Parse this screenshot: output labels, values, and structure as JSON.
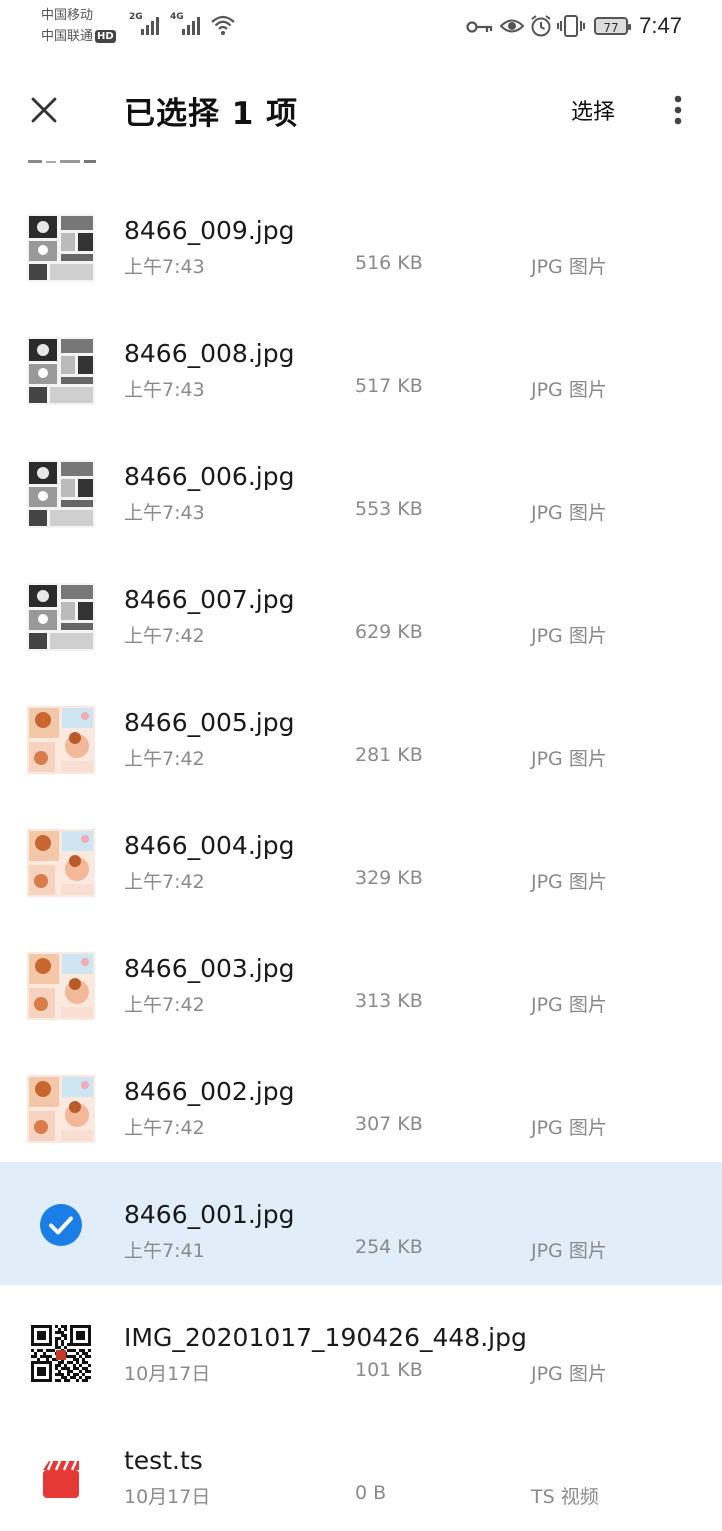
{
  "status_bar": {
    "carrier1": "中国移动",
    "carrier2": "中国联通",
    "hd": "HD",
    "net1": "2G",
    "net2": "4G",
    "battery": "77",
    "time": "7:47"
  },
  "appbar": {
    "title": "已选择 1 项",
    "select_label": "选择"
  },
  "files": [
    {
      "name": "8466_009.jpg",
      "time": "上午7:43",
      "size": "516 KB",
      "type": "JPG 图片",
      "selected": false,
      "thumb": "manga-bw"
    },
    {
      "name": "8466_008.jpg",
      "time": "上午7:43",
      "size": "517 KB",
      "type": "JPG 图片",
      "selected": false,
      "thumb": "manga-bw"
    },
    {
      "name": "8466_006.jpg",
      "time": "上午7:43",
      "size": "553 KB",
      "type": "JPG 图片",
      "selected": false,
      "thumb": "manga-bw"
    },
    {
      "name": "8466_007.jpg",
      "time": "上午7:42",
      "size": "629 KB",
      "type": "JPG 图片",
      "selected": false,
      "thumb": "manga-bw"
    },
    {
      "name": "8466_005.jpg",
      "time": "上午7:42",
      "size": "281 KB",
      "type": "JPG 图片",
      "selected": false,
      "thumb": "manga-color"
    },
    {
      "name": "8466_004.jpg",
      "time": "上午7:42",
      "size": "329 KB",
      "type": "JPG 图片",
      "selected": false,
      "thumb": "manga-color"
    },
    {
      "name": "8466_003.jpg",
      "time": "上午7:42",
      "size": "313 KB",
      "type": "JPG 图片",
      "selected": false,
      "thumb": "manga-color"
    },
    {
      "name": "8466_002.jpg",
      "time": "上午7:42",
      "size": "307 KB",
      "type": "JPG 图片",
      "selected": false,
      "thumb": "manga-color"
    },
    {
      "name": "8466_001.jpg",
      "time": "上午7:41",
      "size": "254 KB",
      "type": "JPG 图片",
      "selected": true,
      "thumb": "check"
    },
    {
      "name": "IMG_20201017_190426_448.jpg",
      "time": "10月17日",
      "size": "101 KB",
      "type": "JPG 图片",
      "selected": false,
      "thumb": "qr"
    },
    {
      "name": "test.ts",
      "time": "10月17日",
      "size": "0 B",
      "type": "TS 视频",
      "selected": false,
      "thumb": "video"
    }
  ],
  "colors": {
    "selected_bg": "#e1eefa",
    "check_blue": "#1a7ee6",
    "video_red": "#e53935"
  }
}
